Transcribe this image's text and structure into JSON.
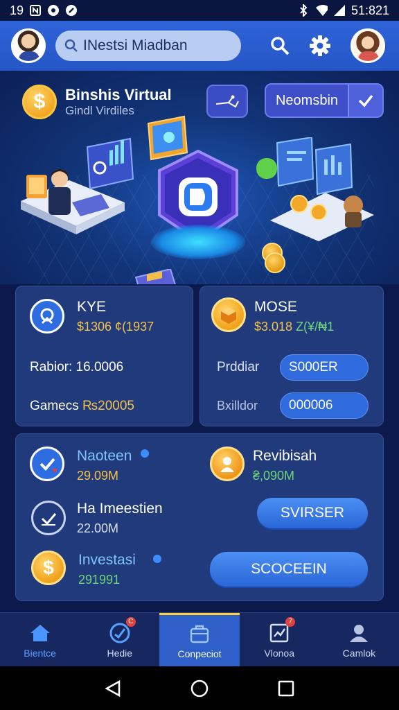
{
  "status_bar": {
    "time_left": "19",
    "time_right": "51:821"
  },
  "header": {
    "search_text": "INestsi Miadban"
  },
  "hero": {
    "brand_title": "Binshis Virtual",
    "brand_subtitle": "Gindl Virdiles",
    "connect_label": "Neomsbin"
  },
  "card_kyc": {
    "title": "KYE",
    "amount": "$1306 ¢(1937",
    "row1": "Rabior: 16.0006",
    "row2_label": "Gamecs ",
    "row2_value": "₨20005"
  },
  "card_mose": {
    "title": "MOSE",
    "amount_a": "$3.018 ",
    "amount_b": "Z(¥/₦1",
    "row1_label": "Prddiar",
    "row1_button": "S000ER",
    "row2_label": "Bxilldor",
    "row2_value": "000006"
  },
  "panel": {
    "item1_title": "Naoteen",
    "item1_value": "29.09M",
    "item2_title": "Revibisah",
    "item2_value": "₴,090M",
    "item3_title": "Ha Imeestien",
    "item3_value": "22.00M",
    "item3_button": "SVIRSER",
    "item4_title": "Investasi",
    "item4_value": "291991",
    "item4_button": "SCOCEEIN"
  },
  "nav": {
    "items": [
      {
        "label": "Bientce"
      },
      {
        "label": "Hedie",
        "badge": "C"
      },
      {
        "label": "Conpeciot"
      },
      {
        "label": "Vlonoa",
        "badge": "7"
      },
      {
        "label": "Camlok"
      }
    ]
  },
  "colors": {
    "header": "#2f63d8",
    "background": "#0b1a4a",
    "card": "#203a7c",
    "amount_gold": "#f4c247",
    "amount_green": "#6fd67a",
    "accent_button": "#2f6bdd",
    "nav_active": "#2f5fc9"
  },
  "icons": {
    "header": [
      "avatar",
      "search-icon",
      "gear-icon",
      "avatar"
    ],
    "nav": [
      "home-icon",
      "chart-icon",
      "briefcase-icon",
      "graph-icon",
      "user-icon"
    ]
  }
}
